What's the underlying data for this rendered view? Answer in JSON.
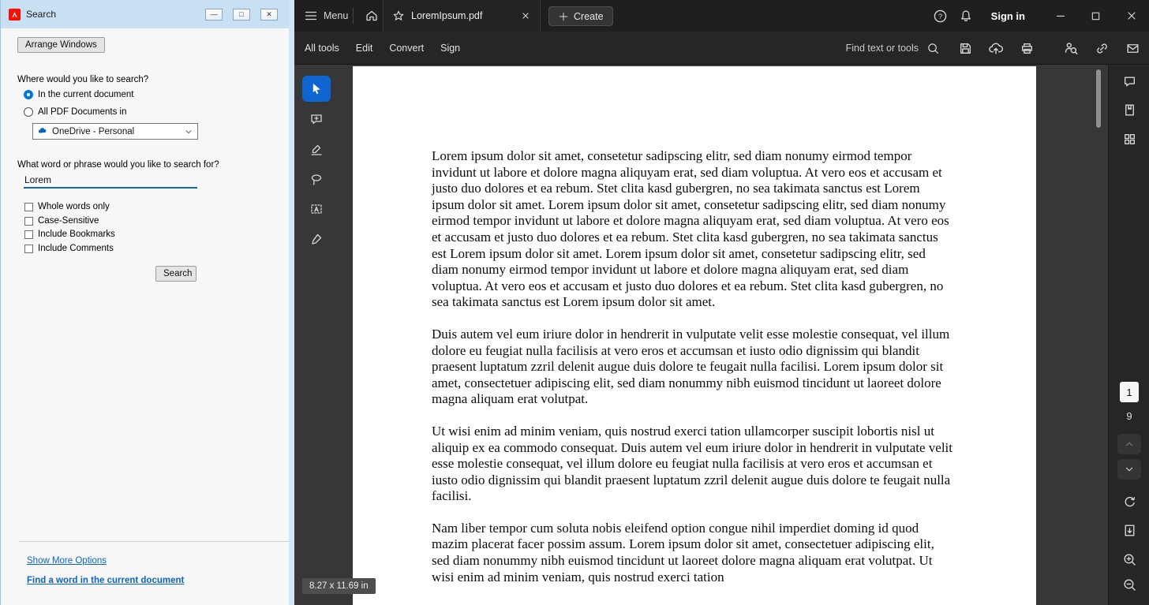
{
  "colors": {
    "accent-blue": "#0f65d0",
    "radio-blue": "#0078d7",
    "underline-blue": "#0f65d0",
    "link-blue": "#0b63c5",
    "adobe-red": "#fa0f00",
    "titlebar-blue": "#c9dff2"
  },
  "search_window": {
    "title": "Search",
    "arrange_windows_label": "Arrange Windows",
    "where_question": "Where would you like to search?",
    "radio_current_label": "In the current document",
    "radio_all_label": "All PDF Documents in",
    "location_dropdown_value": "OneDrive - Personal",
    "phrase_question": "What word or phrase would you like to search for?",
    "search_input_value": "Lorem",
    "checkbox_labels": [
      "Whole words only",
      "Case-Sensitive",
      "Include Bookmarks",
      "Include Comments"
    ],
    "search_button_label": "Search",
    "show_more_options_link": "Show More Options",
    "find_word_link": "Find a word in the current document"
  },
  "app": {
    "menu_label": "Menu",
    "tab_title": "LoremIpsum.pdf",
    "create_button_label": "Create",
    "sign_in_label": "Sign in",
    "nav_items": [
      "All tools",
      "Edit",
      "Convert",
      "Sign"
    ],
    "find_placeholder": "Find text or tools"
  },
  "viewer": {
    "page_size_badge": "8.27 x 11.69 in",
    "current_page": "1",
    "total_pages": "9"
  },
  "document": {
    "paragraphs": [
      "Lorem ipsum dolor sit amet, consetetur sadipscing elitr, sed diam nonumy eirmod tempor invidunt ut labore et dolore magna aliquyam erat, sed diam voluptua. At vero eos et accusam et justo duo dolores et ea rebum. Stet clita kasd gubergren, no sea takimata sanctus est Lorem ipsum dolor sit amet. Lorem ipsum dolor sit amet, consetetur sadipscing elitr, sed diam nonumy eirmod tempor invidunt ut labore et dolore magna aliquyam erat, sed diam voluptua. At vero eos et accusam et justo duo dolores et ea rebum. Stet clita kasd gubergren, no sea takimata sanctus est Lorem ipsum dolor sit amet. Lorem ipsum dolor sit amet, consetetur sadipscing elitr, sed diam nonumy eirmod tempor invidunt ut labore et dolore magna aliquyam erat, sed diam voluptua. At vero eos et accusam et justo duo dolores et ea rebum. Stet clita kasd gubergren, no sea takimata sanctus est Lorem ipsum dolor sit amet.",
      "Duis autem vel eum iriure dolor in hendrerit in vulputate velit esse molestie consequat, vel illum dolore eu feugiat nulla facilisis at vero eros et accumsan et iusto odio dignissim qui blandit praesent luptatum zzril delenit augue duis dolore te feugait nulla facilisi. Lorem ipsum dolor sit amet, consectetuer adipiscing elit, sed diam nonummy nibh euismod tincidunt ut laoreet dolore magna aliquam erat volutpat.",
      "Ut wisi enim ad minim veniam, quis nostrud exerci tation ullamcorper suscipit lobortis nisl ut aliquip ex ea commodo consequat. Duis autem vel eum iriure dolor in hendrerit in vulputate velit esse molestie consequat, vel illum dolore eu feugiat nulla facilisis at vero eros et accumsan et iusto odio dignissim qui blandit praesent luptatum zzril delenit augue duis dolore te feugait nulla facilisi.",
      "Nam liber tempor cum soluta nobis eleifend option congue nihil imperdiet doming id quod mazim placerat facer possim assum. Lorem ipsum dolor sit amet, consectetuer adipiscing elit, sed diam nonummy nibh euismod tincidunt ut laoreet dolore magna aliquam erat volutpat. Ut wisi enim ad minim veniam, quis nostrud exerci tation"
    ]
  }
}
